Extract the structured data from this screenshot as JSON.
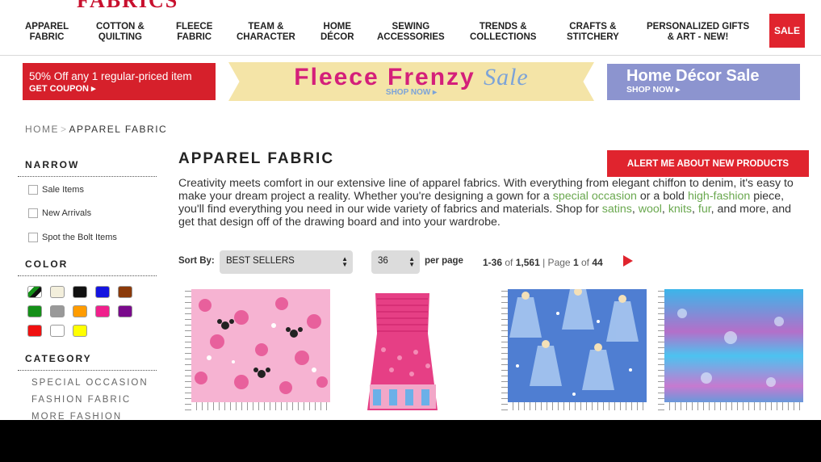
{
  "header": {
    "logo_text": "FABRICS",
    "nav": [
      {
        "label": "APPAREL\nFABRIC"
      },
      {
        "label": "COTTON &\nQUILTING"
      },
      {
        "label": "FLEECE\nFABRIC"
      },
      {
        "label": "TEAM &\nCHARACTER"
      },
      {
        "label": "HOME\nDÉCOR"
      },
      {
        "label": "SEWING\nACCESSORIES"
      },
      {
        "label": "TRENDS &\nCOLLECTIONS"
      },
      {
        "label": "CRAFTS &\nSTITCHERY"
      },
      {
        "label": "PERSONALIZED GIFTS\n& ART - NEW!"
      }
    ],
    "sale_label": "SALE"
  },
  "banners": {
    "coupon": {
      "headline": "50% Off any 1 regular-priced item",
      "cta": "GET COUPON ▸"
    },
    "fleece": {
      "title": "Fleece Frenzy",
      "title_script": "Sale",
      "cta": "SHOP NOW ▸"
    },
    "decor": {
      "title": "Home Décor Sale",
      "cta": "SHOP NOW ▸"
    }
  },
  "breadcrumb": {
    "home": "HOME",
    "separator": ">",
    "current": "APPAREL FABRIC"
  },
  "sidebar": {
    "narrow_heading": "NARROW",
    "narrow_options": [
      "Sale Items",
      "New Arrivals",
      "Spot the Bolt Items"
    ],
    "color_heading": "COLOR",
    "colors": [
      "multi",
      "#f3efdc",
      "#111111",
      "#1414e0",
      "#8b3a0a",
      "#149018",
      "#999999",
      "#ff9c00",
      "#f0208c",
      "#7a0a8c",
      "#f01010",
      "#ffffff",
      "#ffff00"
    ],
    "category_heading": "CATEGORY",
    "categories": [
      "SPECIAL OCCASION",
      "FASHION FABRIC",
      "MORE FASHION"
    ]
  },
  "main": {
    "title": "APPAREL FABRIC",
    "alert_button": "ALERT ME ABOUT NEW PRODUCTS",
    "intro": [
      {
        "text": "Creativity meets comfort in our extensive line of apparel fabrics. With everything from elegant chiffon to denim, it's easy to make your dream project a reality. Whether you're designing a gown for a ",
        "link": false
      },
      {
        "text": "special occasion",
        "link": true
      },
      {
        "text": " or a bold ",
        "link": false
      },
      {
        "text": "high-fashion",
        "link": true
      },
      {
        "text": " piece, you'll find everything you need in our wide variety of fabrics and materials. Shop for ",
        "link": false
      },
      {
        "text": "satins",
        "link": true
      },
      {
        "text": ", ",
        "link": false
      },
      {
        "text": "wool",
        "link": true
      },
      {
        "text": ", ",
        "link": false
      },
      {
        "text": "knits",
        "link": true
      },
      {
        "text": ", ",
        "link": false
      },
      {
        "text": "fur",
        "link": true
      },
      {
        "text": ", and more, and get that design off of the drawing board and into your wardrobe.",
        "link": false
      }
    ],
    "sort_label": "Sort By:",
    "sort_value": "BEST SELLERS",
    "per_page_value": "36",
    "per_page_label": "per page",
    "results_range": "1-36",
    "results_of": "of",
    "results_total": "1,561",
    "page_label": "| Page",
    "page_current": "1",
    "page_of": "of",
    "page_total": "44"
  }
}
